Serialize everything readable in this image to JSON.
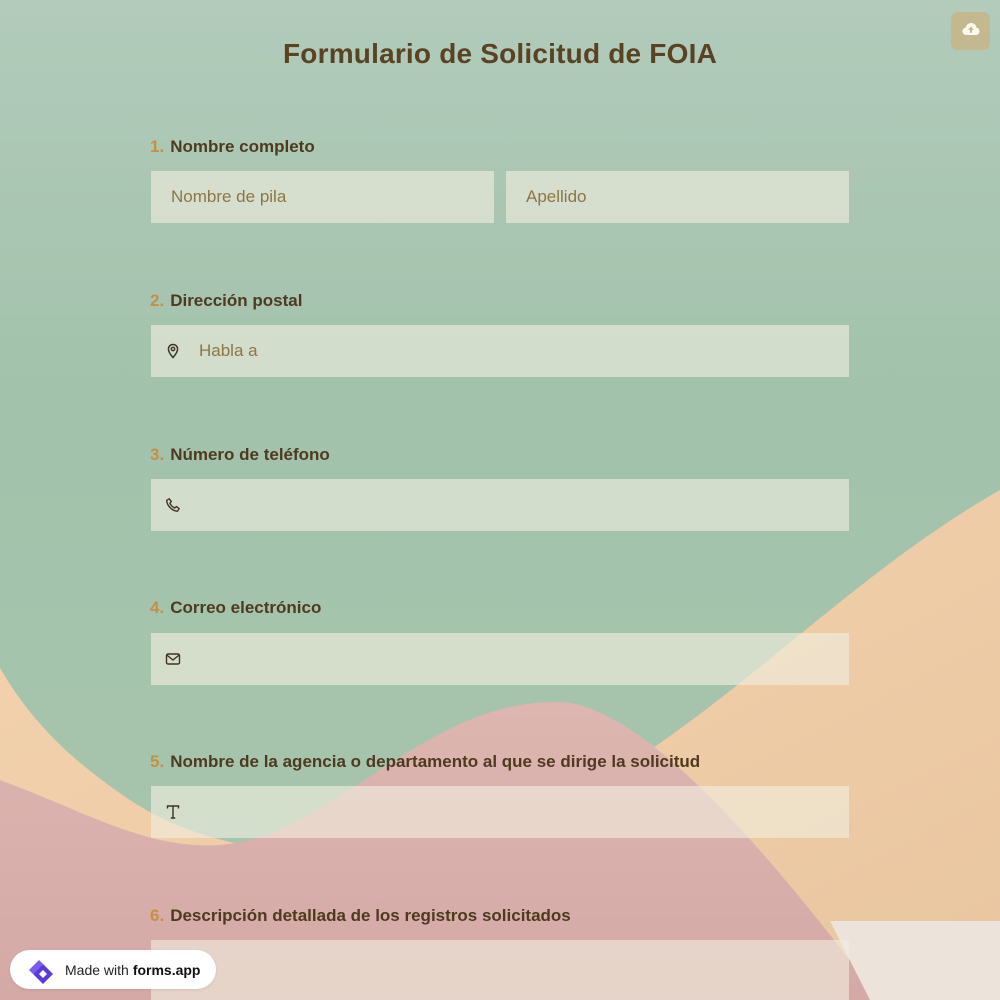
{
  "form": {
    "title": "Formulario de Solicitud de FOIA",
    "questions": [
      {
        "number": "1.",
        "label": "Nombre completo",
        "placeholders": [
          "Nombre de pila",
          "Apellido"
        ]
      },
      {
        "number": "2.",
        "label": "Dirección postal",
        "placeholder": "Habla a",
        "icon": "location-pin-icon"
      },
      {
        "number": "3.",
        "label": "Número de teléfono",
        "placeholder": "",
        "icon": "phone-icon"
      },
      {
        "number": "4.",
        "label": "Correo electrónico",
        "placeholder": "",
        "icon": "envelope-icon"
      },
      {
        "number": "5.",
        "label": "Nombre de la agencia o departamento al que se dirige la solicitud",
        "placeholder": "",
        "icon": "text-t-icon"
      },
      {
        "number": "6.",
        "label": "Descripción detallada de los registros solicitados",
        "placeholder": ""
      }
    ]
  },
  "toolbar": {
    "save_icon": "cloud-upload-icon"
  },
  "badge": {
    "prefix": "Made with",
    "brand": "forms.app"
  },
  "colors": {
    "title": "#5a4322",
    "number_accent": "#c39046",
    "label": "#4e3a1f",
    "background_green": "#a6c6ad",
    "wave_peach": "#f1cfa6",
    "wave_pink": "#d8b0ac",
    "field_fill": "#f0eede"
  }
}
